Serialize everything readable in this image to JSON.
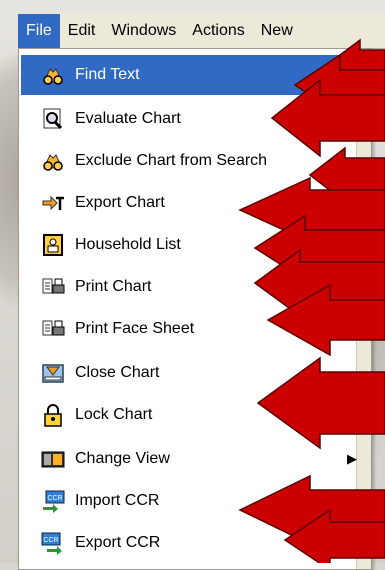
{
  "menubar": {
    "items": [
      "File",
      "Edit",
      "Windows",
      "Actions",
      "New"
    ]
  },
  "file_menu": {
    "items": [
      {
        "label": "Find Text",
        "icon": "binoculars-icon"
      },
      {
        "label": "Evaluate Chart",
        "icon": "magnifier-chart-icon"
      },
      {
        "label": "Exclude Chart from Search",
        "icon": "binoculars-icon"
      },
      {
        "label": "Export Chart",
        "icon": "export-arrow-icon"
      },
      {
        "label": "Household List",
        "icon": "household-icon"
      },
      {
        "label": "Print Chart",
        "icon": "printer-icon"
      },
      {
        "label": "Print Face Sheet",
        "icon": "printer-icon"
      },
      {
        "label": "Close Chart",
        "icon": "close-chart-icon"
      },
      {
        "label": "Lock Chart",
        "icon": "padlock-icon"
      },
      {
        "label": "Change View",
        "icon": "change-view-icon",
        "submenu": "▶"
      },
      {
        "label": "Import CCR",
        "icon": "ccr-import-icon"
      },
      {
        "label": "Export CCR",
        "icon": "ccr-export-icon"
      }
    ]
  },
  "colors": {
    "highlight": "#316ac5",
    "arrow": "#cc0000"
  }
}
